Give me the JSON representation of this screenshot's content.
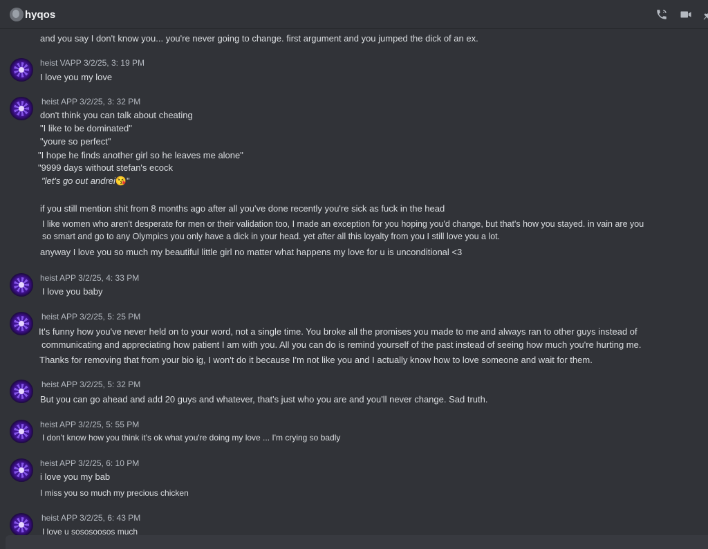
{
  "header": {
    "title": "hyqos",
    "icons": {
      "call": "phone-call-icon",
      "video": "video-camera-icon",
      "pin": "pin-icon"
    }
  },
  "messages": {
    "intro_line": "and you say I don't know you... you're never going to change. first argument and you jumped the dick of an ex.",
    "m1": {
      "author": "heist VAPP",
      "time": "3/2/25, 3: 19 PM",
      "lines": [
        "I love you my love"
      ]
    },
    "m2": {
      "author": "heist APP",
      "time": "3/2/25, 3: 32 PM",
      "lines": [
        "don't think you can talk about cheating",
        "\"I like to be dominated\"",
        "\"youre so perfect\"",
        "\"I hope he finds another girl so he leaves me alone\"",
        "\"9999 days without stefan's ecock",
        "\"let's go out andrei",
        "if you still mention shit from 8 months ago after all you've done recently you're sick as fuck in the head",
        "I like women who aren't desperate for men or their validation too, I made an exception for you hoping you'd change, but that's how you stayed. in vain are you",
        "so smart and go to any Olympics you only have a dick in your head. yet after all this loyalty from you I still love you a lot.",
        "anyway I love you so much my beautiful little girl no matter what happens my love for u is unconditional <3"
      ],
      "emoji_suffix": "😘\""
    },
    "m3": {
      "author": "heist APP",
      "time": "3/2/25, 4: 33 PM",
      "lines": [
        "I love you baby"
      ]
    },
    "m4": {
      "author": "heist APP",
      "time": "3/2/25, 5: 25 PM",
      "lines": [
        "It's funny how you've never held on to your word, not a single time. You broke all the promises you made to me and always ran to other guys instead of",
        "communicating and appreciating how patient I am with you. All you can do is remind yourself of the past instead of seeing how much you're hurting me.",
        "Thanks for removing that from your bio ig, I won't do it because I'm not like you and I actually know how to love someone and wait for them."
      ]
    },
    "m5": {
      "author": "heist APP",
      "time": "3/2/25, 5: 32 PM",
      "lines": [
        "But you can go ahead and add 20 guys and whatever, that's just who you are and you'll never change. Sad truth."
      ]
    },
    "m6": {
      "author": "heist APP",
      "time": "3/2/25, 5: 55 PM",
      "lines": [
        "I don't know how you think it's ok what you're doing my love ... I'm crying so badly"
      ]
    },
    "m7": {
      "author": "heist APP",
      "time": "3/2/25, 6: 10 PM",
      "lines": [
        "i love you my bab",
        "I miss you so much my precious chicken"
      ]
    },
    "m8": {
      "author": "heist APP",
      "time": "3/2/25, 6: 43 PM",
      "lines": [
        "I love u sososoosos much"
      ]
    }
  }
}
